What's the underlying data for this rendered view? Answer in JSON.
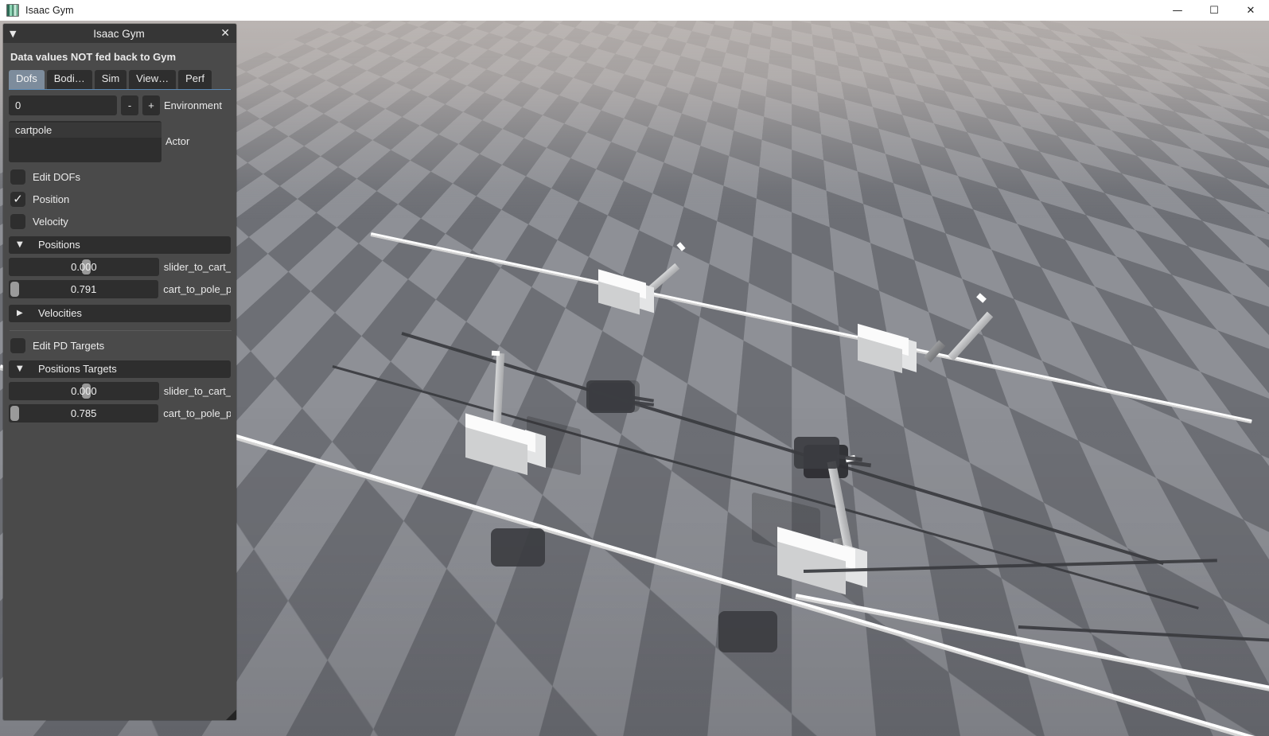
{
  "window": {
    "title": "Isaac Gym",
    "icon": "app-icon",
    "controls": {
      "minimize": "—",
      "maximize": "☐",
      "close": "✕"
    }
  },
  "panel": {
    "title": "Isaac Gym",
    "collapse_icon": "▼",
    "close_icon": "✕",
    "notice": "Data values NOT fed back to Gym",
    "tabs": [
      {
        "label": "Dofs",
        "active": true
      },
      {
        "label": "Bodi…",
        "active": false
      },
      {
        "label": "Sim",
        "active": false
      },
      {
        "label": "View…",
        "active": false
      },
      {
        "label": "Perf",
        "active": false
      }
    ],
    "environment": {
      "value": "0",
      "decrement_label": "-",
      "increment_label": "+",
      "label": "Environment"
    },
    "actor": {
      "label": "Actor",
      "items": [
        "cartpole"
      ],
      "selected": "cartpole"
    },
    "checkboxes": [
      {
        "label": "Edit DOFs",
        "checked": false
      },
      {
        "label": "Position",
        "checked": true
      },
      {
        "label": "Velocity",
        "checked": false
      }
    ],
    "sections": [
      {
        "name": "positions",
        "title": "Positions",
        "expanded": true,
        "caret": "▼",
        "sliders": [
          {
            "value": "0.000",
            "name": "slider_to_cart_",
            "handle_pct": 50
          },
          {
            "value": "0.791",
            "name": "cart_to_pole_p",
            "handle_pct": 1
          }
        ]
      },
      {
        "name": "velocities",
        "title": "Velocities",
        "expanded": false,
        "caret": "▶",
        "sliders": []
      }
    ],
    "pd_checkbox": {
      "label": "Edit PD Targets",
      "checked": false
    },
    "targets_section": {
      "name": "positions-targets",
      "title": "Positions Targets",
      "expanded": true,
      "caret": "▼",
      "sliders": [
        {
          "value": "0.000",
          "name": "slider_to_cart_",
          "handle_pct": 50
        },
        {
          "value": "0.785",
          "name": "cart_to_pole_p",
          "handle_pct": 1
        }
      ]
    }
  },
  "viewport": {
    "name": "isaac-gym-3d-viewport",
    "scene": "cartpole-simulation",
    "floor": {
      "type": "checkerboard",
      "light": "#8e9096",
      "dark": "#6d6f75"
    },
    "actors": [
      {
        "id": "cartpole-0",
        "pole_angle_deg": 63,
        "cart_color": "#fbfbfb"
      },
      {
        "id": "cartpole-1",
        "pole_angle_deg": 50,
        "cart_color": "#fbfbfb"
      },
      {
        "id": "cartpole-2",
        "pole_angle_deg": 5,
        "cart_color": "#fbfbfb"
      },
      {
        "id": "cartpole-3",
        "pole_angle_deg": -14,
        "cart_color": "#fbfbfb"
      }
    ]
  }
}
